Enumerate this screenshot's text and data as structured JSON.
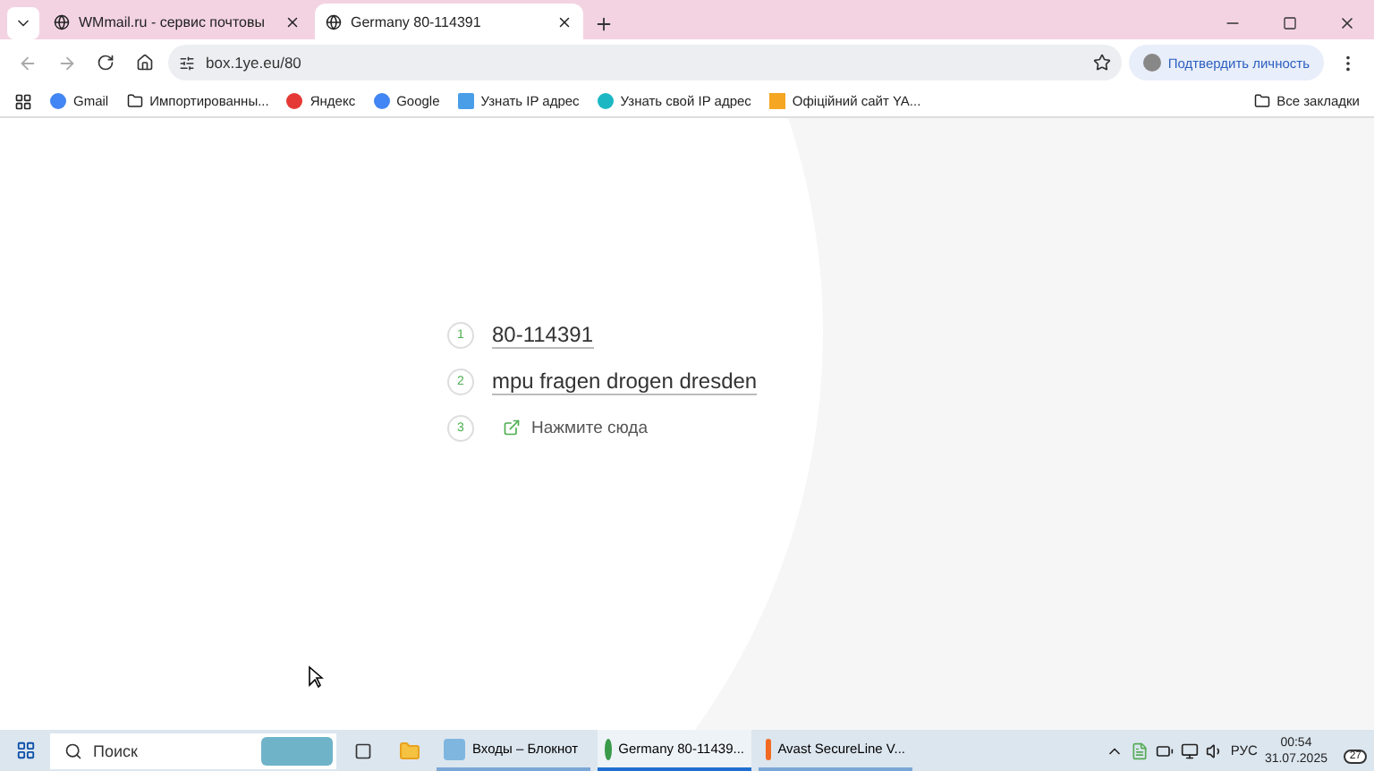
{
  "tabs": [
    {
      "title": "WMmail.ru - сервис почтовы",
      "selected": false
    },
    {
      "title": "Germany 80-114391",
      "selected": true
    }
  ],
  "address": "box.1ye.eu/80",
  "profile_button": "Подтвердить личность",
  "bookmarks": [
    {
      "label": "Gmail",
      "kind": "g"
    },
    {
      "label": "Импортированны...",
      "kind": "folder"
    },
    {
      "label": "Яндекс",
      "kind": "ya"
    },
    {
      "label": "Google",
      "kind": "g"
    },
    {
      "label": "Узнать IP адрес",
      "kind": "ip"
    },
    {
      "label": "Узнать свой IP адрес",
      "kind": "w"
    },
    {
      "label": "Офіційний сайт YA...",
      "kind": "y"
    }
  ],
  "all_bookmarks": "Все закладки",
  "steps": [
    {
      "number": "1",
      "text": "80-114391",
      "kind": "title"
    },
    {
      "number": "2",
      "text": "mpu fragen drogen dresden",
      "kind": "title"
    },
    {
      "number": "3",
      "text": "Нажмите сюда",
      "kind": "link"
    }
  ],
  "taskbar": {
    "search_placeholder": "Поиск",
    "apps": [
      {
        "label": "Входы – Блокнот",
        "kind": "notepad",
        "selected": false
      },
      {
        "label": "Germany 80-11439...",
        "kind": "chrome",
        "selected": true
      },
      {
        "label": "Avast SecureLine V...",
        "kind": "avast",
        "selected": false
      }
    ],
    "language": "РУС",
    "time": "00:54",
    "date": "31.07.2025",
    "notifications": "27"
  }
}
